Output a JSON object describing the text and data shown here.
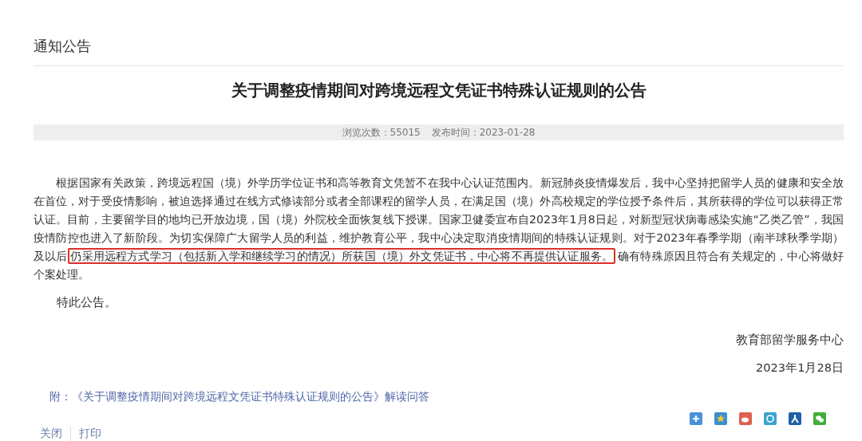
{
  "section_title": "通知公告",
  "article": {
    "title": "关于调整疫情期间对跨境远程文凭证书特殊认证规则的公告",
    "meta": [
      {
        "text": "浏览次数：55015"
      },
      {
        "text": "发布时间：2023-01-28"
      }
    ],
    "body": {
      "before": "根据国家有关政策，跨境远程国（境）外学历学位证书和高等教育文凭暂不在我中心认证范围内。新冠肺炎疫情爆发后，我中心坚持把留学人员的健康和安全放在首位，对于受疫情影响，被迫选择通过在线方式修读部分或者全部课程的留学人员，在满足国（境）外高校规定的学位授予条件后，其所获得的学位可以获得正常认证。目前，主要留学目的地均已开放边境，国（境）外院校全面恢复线下授课。国家卫健委宣布自2023年1月8日起，对新型冠状病毒感染实施“乙类乙管”，我国疫情防控也进入了新阶段。为切实保障广大留学人员的利益，维护教育公平，我中心决定取消疫情期间的特殊认证规则。对于2023年春季学期（南半球秋季学期）及以后",
      "highlight": "仍采用远程方式学习（包括新入学和继续学习的情况）所获国（境）外文凭证书，中心将不再提供认证服务。",
      "after": "确有特殊原因且符合有关规定的，中心将做好个案处理。"
    },
    "closing": "特此公告。",
    "signature": "教育部留学服务中心",
    "date": "2023年1月28日",
    "attachment": {
      "label": "附：",
      "link": "《关于调整疫情期间对跨境远程文凭证书特殊认证规则的公告》解读问答"
    }
  },
  "actions": [
    {
      "label": "关闭"
    },
    {
      "label": "打印"
    }
  ],
  "share": [
    {
      "kind": "plus"
    },
    {
      "kind": "star"
    },
    {
      "kind": "weibo"
    },
    {
      "kind": "circle"
    },
    {
      "kind": "people"
    },
    {
      "kind": "chat"
    }
  ]
}
